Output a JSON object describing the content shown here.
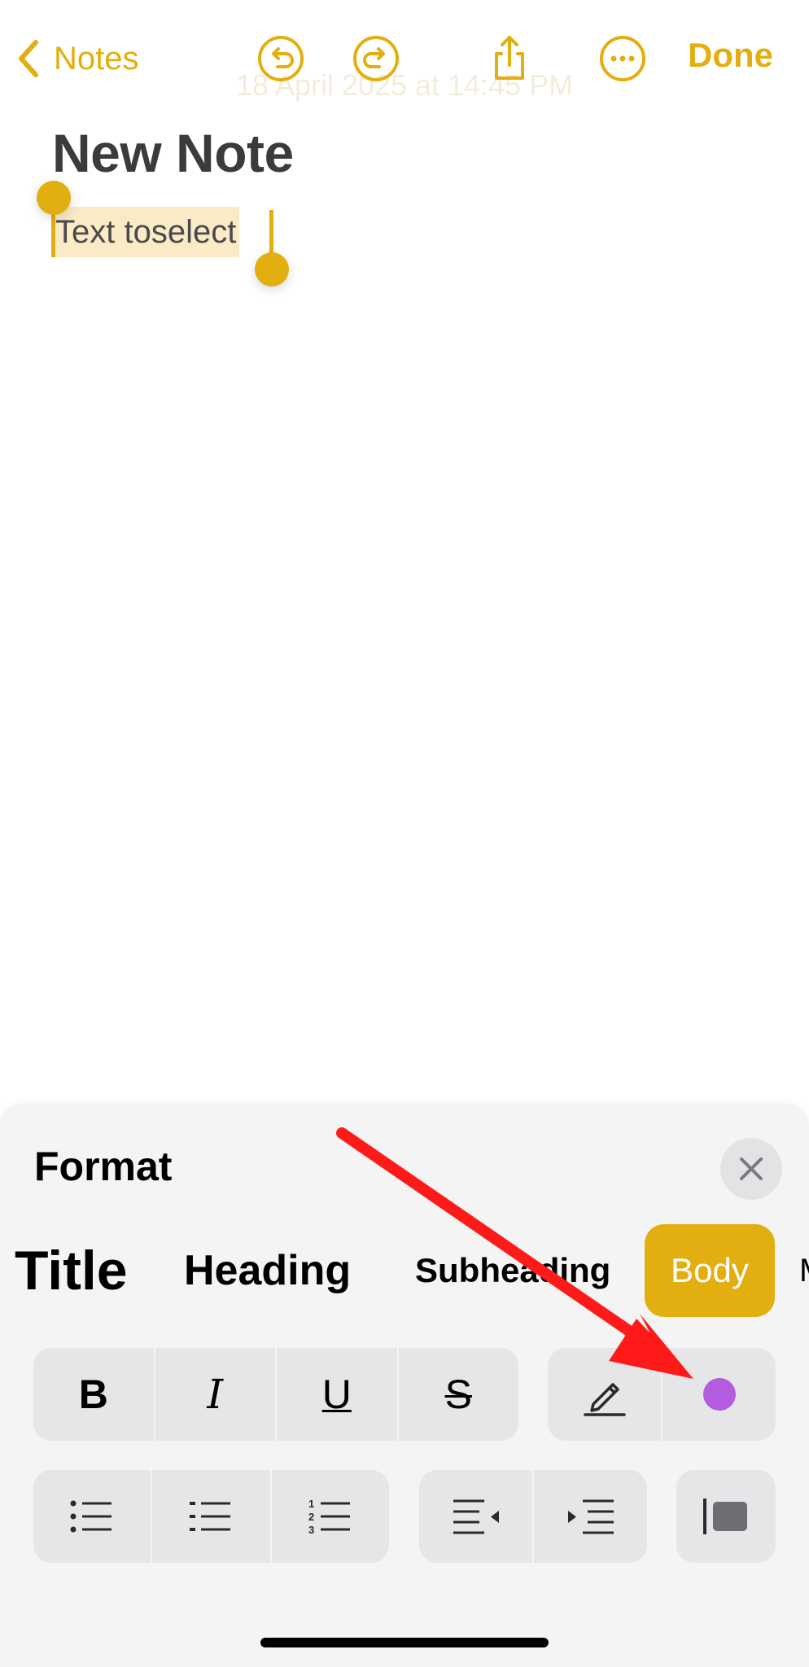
{
  "nav": {
    "back_label": "Notes",
    "done_label": "Done",
    "ghost_date": "18 April 2025 at 14:45 PM"
  },
  "note": {
    "title": "New Note",
    "selected_text_part1": "Text to ",
    "selected_text_part2": "select"
  },
  "format_sheet": {
    "title": "Format",
    "styles": [
      "Title",
      "Heading",
      "Subheading",
      "Body",
      "M"
    ],
    "active_style": "Body",
    "text_buttons": [
      "B",
      "I",
      "U",
      "S"
    ],
    "text_color_dot": "#b25ce0"
  },
  "colors": {
    "accent": "#e3ae0f",
    "annotation_arrow": "#ff1a1a"
  }
}
